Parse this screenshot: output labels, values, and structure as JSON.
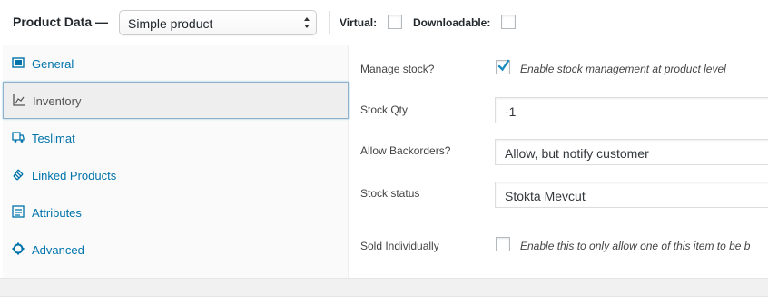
{
  "header": {
    "title": "Product Data —",
    "product_type": "Simple product",
    "virtual_label": "Virtual:",
    "downloadable_label": "Downloadable:"
  },
  "sidebar": {
    "items": [
      {
        "label": "General",
        "icon": "general-icon"
      },
      {
        "label": "Inventory",
        "icon": "inventory-icon"
      },
      {
        "label": "Teslimat",
        "icon": "shipping-icon"
      },
      {
        "label": "Linked Products",
        "icon": "link-icon"
      },
      {
        "label": "Attributes",
        "icon": "attributes-icon"
      },
      {
        "label": "Advanced",
        "icon": "gear-icon"
      }
    ],
    "active": "Inventory"
  },
  "inventory": {
    "manage_stock_label": "Manage stock?",
    "manage_stock_desc": "Enable stock management at product level",
    "manage_stock_checked": true,
    "stock_qty_label": "Stock Qty",
    "stock_qty_value": "-1",
    "backorders_label": "Allow Backorders?",
    "backorders_value": "Allow, but notify customer",
    "stock_status_label": "Stock status",
    "stock_status_value": "Stokta Mevcut",
    "sold_individually_label": "Sold Individually",
    "sold_individually_desc": "Enable this to only allow one of this item to be b",
    "sold_individually_checked": false
  },
  "colors": {
    "link": "#0073aa",
    "check": "#1e8cbe"
  }
}
